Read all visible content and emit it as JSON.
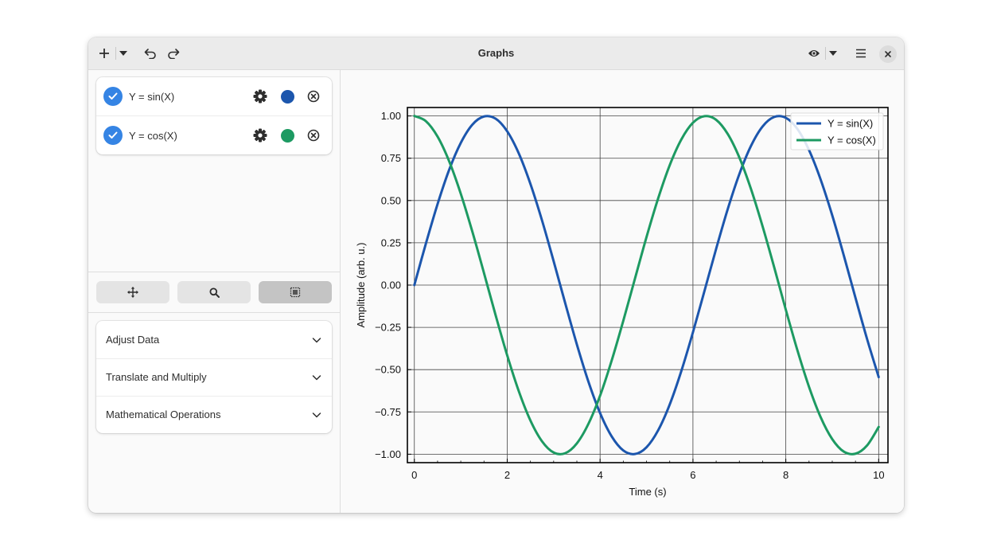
{
  "window": {
    "title": "Graphs"
  },
  "icons": {
    "add": "plus-icon",
    "add_menu": "chevron-down-icon",
    "undo": "undo-icon",
    "redo": "redo-icon",
    "view": "eye-icon",
    "view_menu": "chevron-down-icon",
    "main_menu": "hamburger-icon",
    "close": "close-icon",
    "pan": "move-icon",
    "zoom": "search-icon",
    "select": "select-icon"
  },
  "equations": [
    {
      "label": "Y = sin(X)",
      "color": "#1c56ad",
      "checked": true
    },
    {
      "label": "Y = cos(X)",
      "color": "#1d9a62",
      "checked": true
    }
  ],
  "tools": {
    "active": "select"
  },
  "expanders": [
    {
      "label": "Adjust Data"
    },
    {
      "label": "Translate and Multiply"
    },
    {
      "label": "Mathematical Operations"
    }
  ],
  "chart_data": {
    "type": "line",
    "xlabel": "Time (s)",
    "ylabel": "Amplitude (arb. u.)",
    "xlim": [
      -0.15,
      10.2
    ],
    "ylim": [
      -1.05,
      1.05
    ],
    "xticks": [
      0,
      2,
      4,
      6,
      8,
      10
    ],
    "xtick_labels": [
      "0",
      "2",
      "4",
      "6",
      "8",
      "10"
    ],
    "yticks": [
      1.0,
      0.75,
      0.5,
      0.25,
      0.0,
      -0.25,
      -0.5,
      -0.75,
      -1.0
    ],
    "ytick_labels": [
      "1.00",
      "0.75",
      "0.50",
      "0.25",
      "0.00",
      "−0.25",
      "−0.50",
      "−0.75",
      "−1.00"
    ],
    "grid": true,
    "legend": "top-right",
    "series": [
      {
        "name": "Y = sin(X)",
        "color": "#1c56ad",
        "x": [
          0,
          0.25,
          0.5,
          0.75,
          1,
          1.25,
          1.5,
          1.75,
          2,
          2.25,
          2.5,
          2.75,
          3,
          3.25,
          3.5,
          3.75,
          4,
          4.25,
          4.5,
          4.75,
          5,
          5.25,
          5.5,
          5.75,
          6,
          6.25,
          6.5,
          6.75,
          7,
          7.25,
          7.5,
          7.75,
          8,
          8.25,
          8.5,
          8.75,
          9,
          9.25,
          9.5,
          9.75,
          10
        ],
        "y": [
          0,
          0.247,
          0.479,
          0.682,
          0.841,
          0.949,
          0.997,
          0.984,
          0.909,
          0.778,
          0.598,
          0.382,
          0.141,
          -0.108,
          -0.351,
          -0.572,
          -0.757,
          -0.895,
          -0.978,
          -0.999,
          -0.959,
          -0.859,
          -0.706,
          -0.508,
          -0.279,
          -0.033,
          0.215,
          0.45,
          0.657,
          0.823,
          0.938,
          0.994,
          0.989,
          0.923,
          0.798,
          0.624,
          0.412,
          0.174,
          -0.075,
          -0.319,
          -0.544
        ]
      },
      {
        "name": "Y = cos(X)",
        "color": "#1d9a62",
        "x": [
          0,
          0.25,
          0.5,
          0.75,
          1,
          1.25,
          1.5,
          1.75,
          2,
          2.25,
          2.5,
          2.75,
          3,
          3.25,
          3.5,
          3.75,
          4,
          4.25,
          4.5,
          4.75,
          5,
          5.25,
          5.5,
          5.75,
          6,
          6.25,
          6.5,
          6.75,
          7,
          7.25,
          7.5,
          7.75,
          8,
          8.25,
          8.5,
          8.75,
          9,
          9.25,
          9.5,
          9.75,
          10
        ],
        "y": [
          1,
          0.969,
          0.878,
          0.732,
          0.54,
          0.315,
          0.071,
          -0.178,
          -0.416,
          -0.628,
          -0.801,
          -0.924,
          -0.99,
          -0.994,
          -0.936,
          -0.82,
          -0.654,
          -0.446,
          -0.211,
          0.037,
          0.284,
          0.512,
          0.709,
          0.861,
          0.96,
          0.999,
          0.977,
          0.893,
          0.754,
          0.568,
          0.347,
          0.105,
          -0.146,
          -0.386,
          -0.602,
          -0.781,
          -0.911,
          -0.985,
          -0.997,
          -0.948,
          -0.839
        ]
      }
    ]
  }
}
